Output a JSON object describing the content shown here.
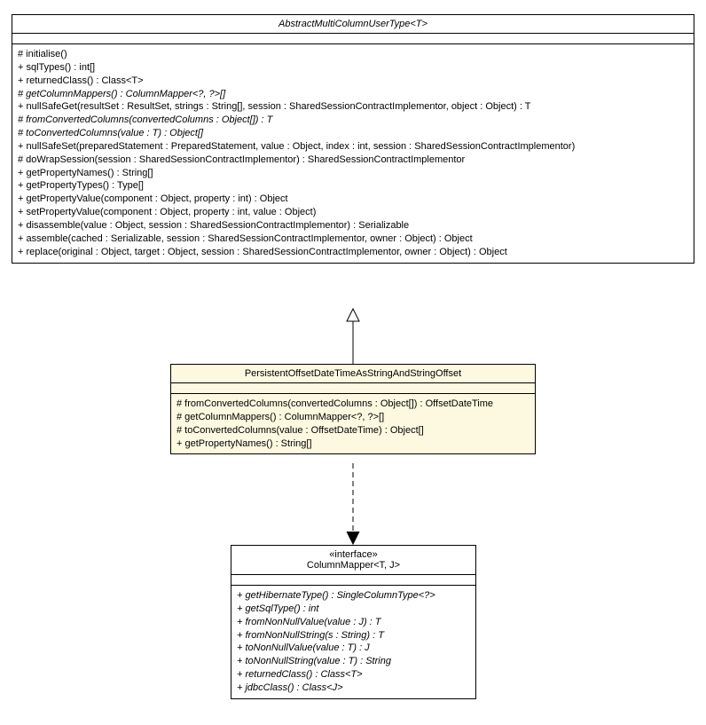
{
  "abstract": {
    "name": "AbstractMultiColumnUserType<T>",
    "members": [
      {
        "text": "# initialise()",
        "italic": false
      },
      {
        "text": "+ sqlTypes() : int[]",
        "italic": false
      },
      {
        "text": "+ returnedClass() : Class<T>",
        "italic": false
      },
      {
        "text": "# getColumnMappers() : ColumnMapper<?, ?>[]",
        "italic": true
      },
      {
        "text": "+ nullSafeGet(resultSet : ResultSet, strings : String[], session : SharedSessionContractImplementor, object : Object) : T",
        "italic": false
      },
      {
        "text": "# fromConvertedColumns(convertedColumns : Object[]) : T",
        "italic": true
      },
      {
        "text": "# toConvertedColumns(value : T) : Object[]",
        "italic": true
      },
      {
        "text": "+ nullSafeSet(preparedStatement : PreparedStatement, value : Object, index : int, session : SharedSessionContractImplementor)",
        "italic": false
      },
      {
        "text": "# doWrapSession(session : SharedSessionContractImplementor) : SharedSessionContractImplementor",
        "italic": false
      },
      {
        "text": "+ getPropertyNames() : String[]",
        "italic": false
      },
      {
        "text": "+ getPropertyTypes() : Type[]",
        "italic": false
      },
      {
        "text": "+ getPropertyValue(component : Object, property : int) : Object",
        "italic": false
      },
      {
        "text": "+ setPropertyValue(component : Object, property : int, value : Object)",
        "italic": false
      },
      {
        "text": "+ disassemble(value : Object, session : SharedSessionContractImplementor) : Serializable",
        "italic": false
      },
      {
        "text": "+ assemble(cached : Serializable, session : SharedSessionContractImplementor, owner : Object) : Object",
        "italic": false
      },
      {
        "text": "+ replace(original : Object, target : Object, session : SharedSessionContractImplementor, owner : Object) : Object",
        "italic": false
      }
    ]
  },
  "persistent": {
    "name": "PersistentOffsetDateTimeAsStringAndStringOffset",
    "members": [
      {
        "text": "# fromConvertedColumns(convertedColumns : Object[]) : OffsetDateTime",
        "italic": false
      },
      {
        "text": "# getColumnMappers() : ColumnMapper<?, ?>[]",
        "italic": false
      },
      {
        "text": "# toConvertedColumns(value : OffsetDateTime) : Object[]",
        "italic": false
      },
      {
        "text": "+ getPropertyNames() : String[]",
        "italic": false
      }
    ]
  },
  "mapper": {
    "stereotype": "«interface»",
    "name": "ColumnMapper<T, J>",
    "members": [
      {
        "text": "+ getHibernateType() : SingleColumnType<?>",
        "italic": true
      },
      {
        "text": "+ getSqlType() : int",
        "italic": true
      },
      {
        "text": "+ fromNonNullValue(value : J) : T",
        "italic": true
      },
      {
        "text": "+ fromNonNullString(s : String) : T",
        "italic": true
      },
      {
        "text": "+ toNonNullValue(value : T) : J",
        "italic": true
      },
      {
        "text": "+ toNonNullString(value : T) : String",
        "italic": true
      },
      {
        "text": "+ returnedClass() : Class<T>",
        "italic": true
      },
      {
        "text": "+ jdbcClass() : Class<J>",
        "italic": true
      }
    ]
  }
}
